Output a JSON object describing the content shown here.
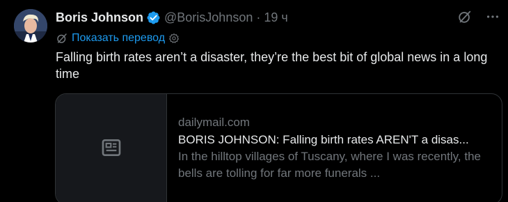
{
  "author": {
    "name": "Boris Johnson",
    "handle": "@BorisJohnson",
    "separator": "·",
    "time": "19 ч",
    "verified": true
  },
  "translate": {
    "label": "Показать перевод"
  },
  "tweet": {
    "text": "Falling birth rates aren’t a disaster, they’re the best bit of global news in a long time"
  },
  "card": {
    "domain": "dailymail.com",
    "title": "BORIS JOHNSON: Falling birth rates AREN'T a disas...",
    "description": "In the hilltop villages of Tuscany, where I was recently, the bells are tolling for far more funerals ..."
  },
  "icons": {
    "verified": "verified-badge-icon",
    "grok": "grok-icon",
    "more": "more-icon",
    "translate": "translate-icon",
    "settings": "gear-icon",
    "article": "article-icon"
  },
  "colors": {
    "background": "#000000",
    "text_primary": "#e7e9ea",
    "text_secondary": "#71767b",
    "accent": "#1d9bf0",
    "border": "#2f3336",
    "card_thumb_bg": "#16181c"
  }
}
